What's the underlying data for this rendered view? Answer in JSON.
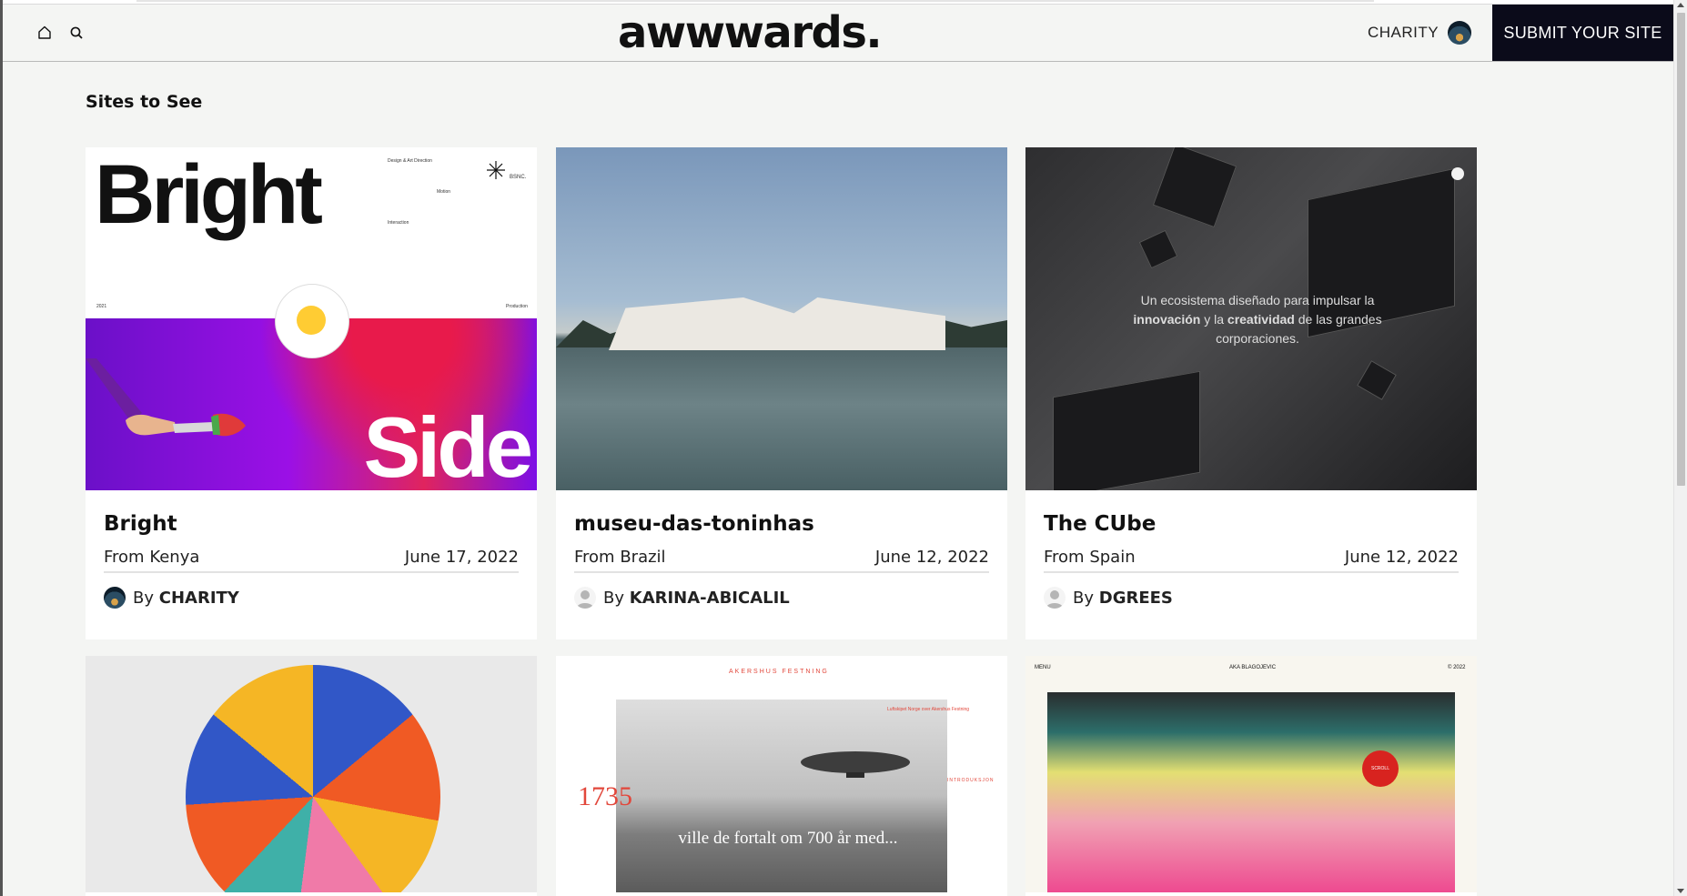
{
  "header": {
    "logo": "awwwards.",
    "user_name": "CHARITY",
    "submit_label": "SUBMIT YOUR SITE",
    "icons": [
      "home-icon",
      "search-icon"
    ]
  },
  "section_title": "Sites to See",
  "cards": [
    {
      "title": "Bright",
      "from": "From Kenya",
      "date": "June 17, 2022",
      "by": "By",
      "author": "CHARITY",
      "thumb": {
        "big1": "Bright",
        "big2": "Side",
        "note1": "Design & Art Direction",
        "note2": "Motion",
        "note3": "Interaction",
        "note4": "2021",
        "note5": "Production",
        "brand": "BSNC."
      }
    },
    {
      "title": "museu-das-toninhas",
      "from": "From Brazil",
      "date": "June 12, 2022",
      "by": "By",
      "author": "KARINA-ABICALIL"
    },
    {
      "title": "The CUbe",
      "from": "From Spain",
      "date": "June 12, 2022",
      "by": "By",
      "author": "DGREES",
      "thumb": {
        "line1": "Un ecosistema diseñado para impulsar la",
        "line2a": "innovación",
        "line2b": " y la ",
        "line2c": "creatividad",
        "line2d": " de las grandes",
        "line3": "corporaciones."
      }
    },
    {
      "title": "",
      "from": "",
      "date": "",
      "by": "",
      "author": ""
    },
    {
      "title": "",
      "from": "",
      "date": "",
      "by": "",
      "author": "",
      "thumb": {
        "brand": "AKERSHUS FESTNING",
        "year": "1735",
        "caption": "ville de fortalt om 700 år med...",
        "side_label": "INTRODUKSJON",
        "credit": "Luftskipet Norge over Akershus Festning"
      }
    },
    {
      "title": "",
      "from": "",
      "date": "",
      "by": "",
      "author": "",
      "thumb": {
        "menu": "MENU",
        "name": "AKA BLAGOJEVIC",
        "year": "© 2022",
        "cta": "SCROLL"
      }
    }
  ],
  "colors": {
    "submit_bg": "#0b0b1a",
    "accent_red": "#e2473b",
    "page_bg": "#f4f5f3"
  }
}
